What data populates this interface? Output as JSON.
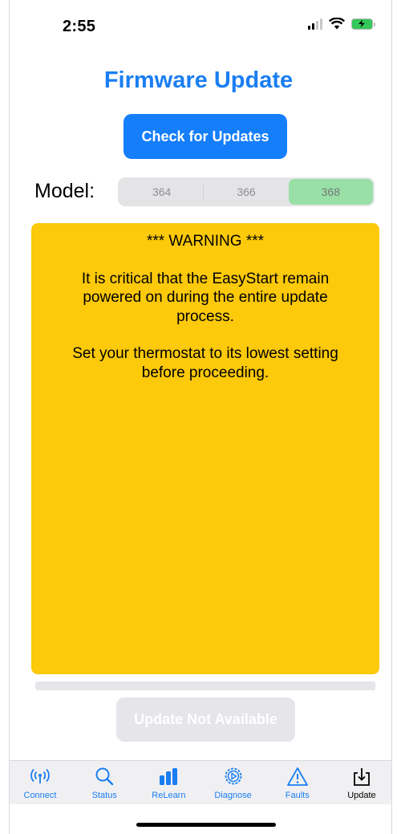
{
  "status_bar": {
    "time": "2:55",
    "wifi_icon": "wifi-icon",
    "battery_icon": "battery-charging-icon"
  },
  "header": {
    "title": "Firmware Update"
  },
  "actions": {
    "check_label": "Check for Updates",
    "update_label": "Update Not Available"
  },
  "model": {
    "label": "Model:",
    "options": [
      "364",
      "366",
      "368"
    ],
    "selected": "368"
  },
  "warning": {
    "heading": "*** WARNING ***",
    "paragraph1": "It is critical that the EasyStart remain powered on during the entire update process.",
    "paragraph2": "Set your thermostat to its lowest setting before proceeding."
  },
  "progress": {
    "fraction": 0
  },
  "tabs": [
    {
      "label": "Connect",
      "icon": "antenna-icon"
    },
    {
      "label": "Status",
      "icon": "search-icon"
    },
    {
      "label": "ReLearn",
      "icon": "bar-chart-icon"
    },
    {
      "label": "Diagnose",
      "icon": "gear-play-icon"
    },
    {
      "label": "Faults",
      "icon": "warning-triangle-icon"
    },
    {
      "label": "Update",
      "icon": "download-tray-icon"
    }
  ],
  "colors": {
    "accent": "#147efb",
    "warning_bg": "#fcc90b",
    "selected_segment": "#98e0a6"
  }
}
